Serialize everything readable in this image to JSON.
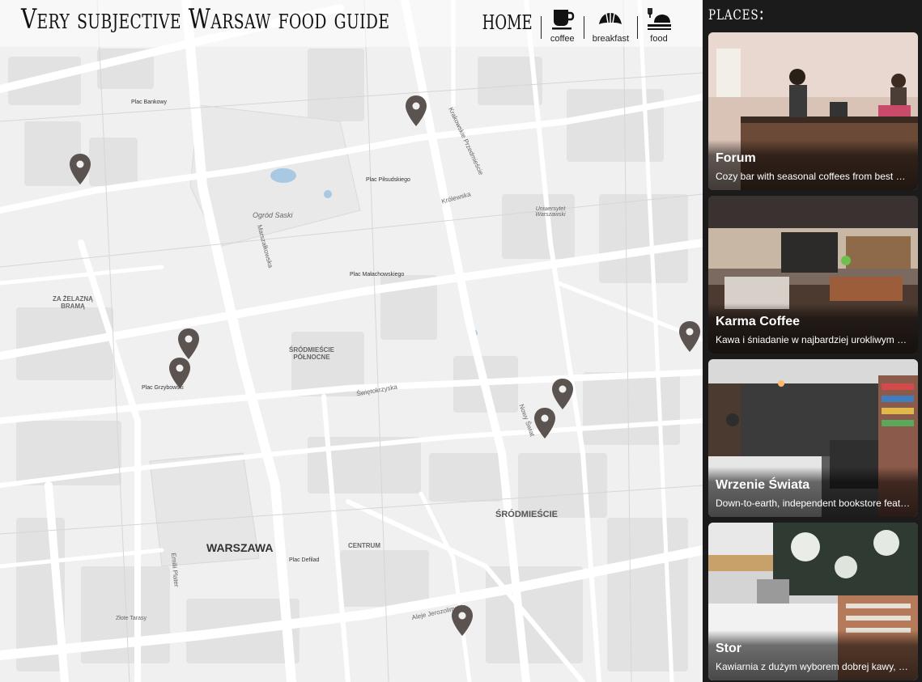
{
  "header": {
    "title": "Very subjective Warsaw food guide",
    "home_label": "HOME",
    "nav": [
      {
        "label": "coffee",
        "icon": "coffee-cup-icon"
      },
      {
        "label": "breakfast",
        "icon": "croissant-icon"
      },
      {
        "label": "food",
        "icon": "plate-icon"
      }
    ]
  },
  "map": {
    "labels": {
      "warszawa": "WARSZAWA",
      "srodmiescie": "ŚRÓDMIEŚCIE",
      "ogrod": "Ogród Saski",
      "zazelazna": "ZA ŻELAZNĄ BRAMĄ",
      "srodpn": "ŚRÓDMIEŚCIE PÓŁNOCNE",
      "centrum": "CENTRUM",
      "plac_grzybowski": "Plac Grzybowski",
      "plac_bankowy": "Plac Bankowy",
      "plac_pilsudskiego": "Plac Piłsudskiego",
      "plac_malachowskiego": "Plac Małachowskiego",
      "plac_defilad": "Plac Defilad",
      "krolewska": "Królewska",
      "swietokrzyska": "Świętokrzyska",
      "marszalkowska": "Marszałkowska",
      "aleje": "Aleje Jerozolimskie",
      "nowy_swiat": "Nowy Świat",
      "krakowskie": "Krakowskie Przedmieście",
      "uniwersytet": "Uniwersytet Warszawski",
      "zlote": "Złote Tarasy",
      "emilii_plater": "Emilii Plater"
    },
    "pin_icon": "map-marker-icon",
    "pin_color": "#5b5350"
  },
  "sidebar": {
    "title": "places:",
    "places": [
      {
        "name": "Forum",
        "description": "Cozy bar with seasonal coffees from best european roasters"
      },
      {
        "name": "Karma Coffee",
        "description": "Kawa i śniadanie w najbardziej urokliwym miejscu"
      },
      {
        "name": "Wrzenie Świata",
        "description": "Down-to-earth, independent bookstore featuring coffee"
      },
      {
        "name": "Stor",
        "description": "Kawiarnia z dużym wyborem dobrej kawy, herbaty"
      }
    ]
  }
}
